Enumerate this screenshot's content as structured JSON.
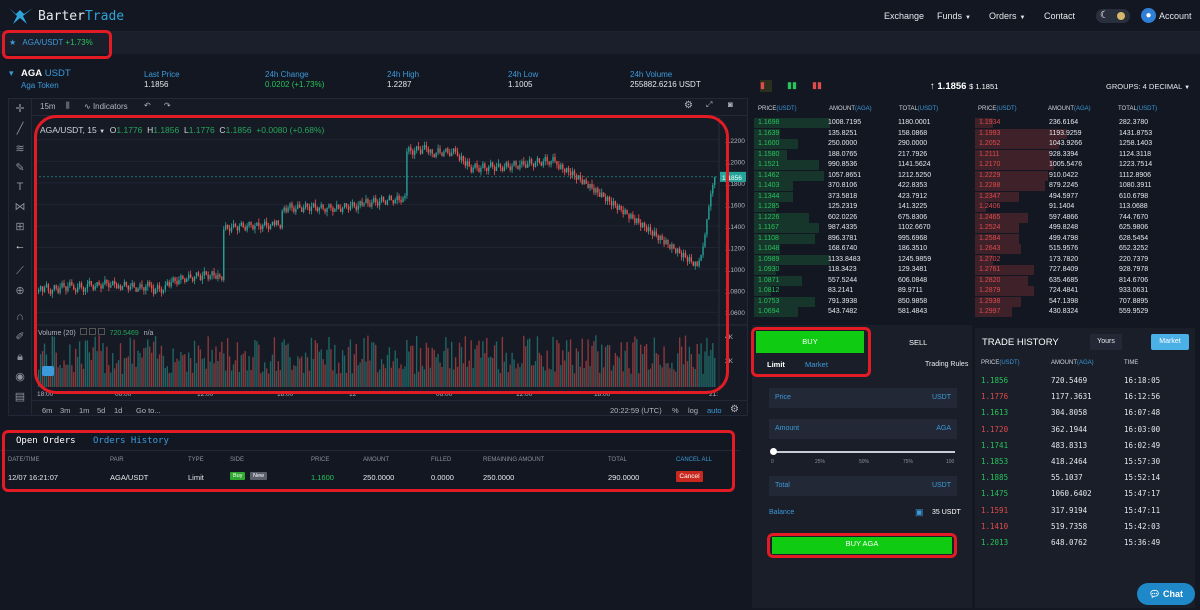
{
  "nav": {
    "brand_a": "Barter",
    "brand_b": "Trade",
    "links": [
      "Exchange",
      "Funds",
      "Orders",
      "Contact"
    ],
    "account": "Account"
  },
  "tab": {
    "pair": "AGA/USDT",
    "change": "+1.73%"
  },
  "ticker": {
    "symbol": "AGA",
    "quote": "USDT",
    "name": "Aga Token",
    "last_price_label": "Last Price",
    "last_price": "1.1856",
    "change_label": "24h Change",
    "change": "0.0202 (+1.73%)",
    "high_label": "24h High",
    "high": "1.2287",
    "low_label": "24h Low",
    "low": "1.1005",
    "volume_label": "24h Volume",
    "volume": "255882.6216 USDT"
  },
  "chart": {
    "interval": "15m",
    "indicators": "Indicators",
    "legend_symbol": "AGA/USDT, 15",
    "o": "1.1776",
    "h": "1.1856",
    "l": "1.1776",
    "c": "1.1856",
    "delta": "+0.0080 (+0.68%)",
    "volume_label": "Volume (20)",
    "volume_value": "720.5469",
    "volume_na": "n/a",
    "price_ticks": [
      "1.2200",
      "1.2000",
      "1.1800",
      "1.1600",
      "1.1400",
      "1.1200",
      "1.1000",
      "1.0800",
      "1.0600"
    ],
    "last_tag": "1.1856",
    "vol_ticks": [
      "4K",
      "2K"
    ],
    "time_ticks": [
      "18:00",
      "06:00",
      "12:00",
      "18:00",
      "12",
      "06:00",
      "12:00",
      "18:00",
      "21:"
    ],
    "ranges": [
      "6m",
      "3m",
      "1m",
      "5d",
      "1d"
    ],
    "goto": "Go to...",
    "clock": "20:22:59 (UTC)",
    "pct": "%",
    "log": "log",
    "auto": "auto",
    "candles": [
      1.081,
      1.084,
      1.079,
      1.083,
      1.086,
      1.08,
      1.077,
      1.081,
      1.085,
      1.082,
      1.078,
      1.083,
      1.087,
      1.084,
      1.08,
      1.084,
      1.088,
      1.085,
      1.081,
      1.079,
      1.083,
      1.087,
      1.083,
      1.079,
      1.082,
      1.086,
      1.089,
      1.085,
      1.081,
      1.084,
      1.088,
      1.085,
      1.082,
      1.086,
      1.09,
      1.087,
      1.083,
      1.085,
      1.089,
      1.086,
      1.082,
      1.085,
      1.081,
      1.084,
      1.088,
      1.085,
      1.081,
      1.084,
      1.087,
      1.083,
      1.079,
      1.082,
      1.086,
      1.083,
      1.08,
      1.084,
      1.088,
      1.085,
      1.082,
      1.077,
      1.081,
      1.085,
      1.082,
      1.078,
      1.081,
      1.085,
      1.088,
      1.084,
      1.088,
      1.092,
      1.089,
      1.086,
      1.09,
      1.094,
      1.091,
      1.088,
      1.091,
      1.095,
      1.092,
      1.089,
      1.093,
      1.097,
      1.094,
      1.09,
      1.094,
      1.098,
      1.095,
      1.091,
      1.094,
      1.098,
      1.094,
      1.091,
      1.095,
      1.093,
      1.09,
      1.137,
      1.141,
      1.138,
      1.135,
      1.139,
      1.142,
      1.139,
      1.136,
      1.14,
      1.143,
      1.139,
      1.136,
      1.14,
      1.144,
      1.141,
      1.137,
      1.14,
      1.143,
      1.14,
      1.137,
      1.141,
      1.144,
      1.14,
      1.137,
      1.141,
      1.144,
      1.141,
      1.145,
      1.141,
      1.138,
      1.154,
      1.157,
      1.153,
      1.157,
      1.161,
      1.157,
      1.153,
      1.156,
      1.16,
      1.157,
      1.153,
      1.157,
      1.161,
      1.158,
      1.154,
      1.158,
      1.161,
      1.157,
      1.154,
      1.157,
      1.16,
      1.156,
      1.153,
      1.157,
      1.16,
      1.157,
      1.153,
      1.156,
      1.16,
      1.156,
      1.153,
      1.157,
      1.161,
      1.158,
      1.155,
      1.159,
      1.162,
      1.158,
      1.155,
      1.159,
      1.163,
      1.159,
      1.161,
      1.165,
      1.161,
      1.158,
      1.162,
      1.166,
      1.162,
      1.159,
      1.163,
      1.167,
      1.163,
      1.16,
      1.164,
      1.168,
      1.164,
      1.161,
      1.164,
      1.168,
      1.164,
      1.162,
      1.166,
      1.168,
      1.209,
      1.213,
      1.21,
      1.206,
      1.21,
      1.214,
      1.211,
      1.207,
      1.211,
      1.215,
      1.212,
      1.208,
      1.211,
      1.207,
      1.204,
      1.208,
      1.212,
      1.208,
      1.205,
      1.209,
      1.212,
      1.208,
      1.205,
      1.208,
      1.212,
      1.209,
      1.205,
      1.201,
      1.205,
      1.2,
      1.196,
      1.2,
      1.195,
      1.19,
      1.194,
      1.198,
      1.194,
      1.19,
      1.194,
      1.198,
      1.194,
      1.191,
      1.195,
      1.199,
      1.195,
      1.191,
      1.195,
      1.198,
      1.194,
      1.191,
      1.195,
      1.199,
      1.195,
      1.192,
      1.196,
      1.2,
      1.196,
      1.193,
      1.197,
      1.2,
      1.197,
      1.194,
      1.198,
      1.202,
      1.198,
      1.195,
      1.199,
      1.203,
      1.199,
      1.196,
      1.2,
      1.204,
      1.2,
      1.197,
      1.2,
      1.204,
      1.2,
      1.197,
      1.193,
      1.197,
      1.193,
      1.19,
      1.194,
      1.19,
      1.187,
      1.191,
      1.187,
      1.183,
      1.187,
      1.183,
      1.179,
      1.183,
      1.179,
      1.175,
      1.179,
      1.175,
      1.171,
      1.175,
      1.171,
      1.167,
      1.171,
      1.167,
      1.163,
      1.167,
      1.163,
      1.159,
      1.163,
      1.159,
      1.155,
      1.159,
      1.155,
      1.151,
      1.155,
      1.151,
      1.147,
      1.151,
      1.147,
      1.143,
      1.147,
      1.143,
      1.139,
      1.143,
      1.139,
      1.135,
      1.139,
      1.135,
      1.131,
      1.135,
      1.131,
      1.127,
      1.131,
      1.127,
      1.123,
      1.127,
      1.123,
      1.119,
      1.123,
      1.119,
      1.115,
      1.119,
      1.115,
      1.111,
      1.115,
      1.111,
      1.107,
      1.111,
      1.107,
      1.103,
      1.107,
      1.103,
      1.108,
      1.113,
      1.121,
      1.132,
      1.146,
      1.158,
      1.17,
      1.178,
      1.1856
    ]
  },
  "orders": {
    "tab_open": "Open Orders",
    "tab_history": "Orders History",
    "headers": [
      "DATE/TIME",
      "PAIR",
      "TYPE",
      "SIDE",
      "PRICE",
      "AMOUNT",
      "FILLED",
      "REMAINING AMOUNT",
      "TOTAL",
      "CANCEL ALL"
    ],
    "row": {
      "date": "12/07 16:21:07",
      "pair": "AGA/USDT",
      "type": "Limit",
      "side": "Buy",
      "tag": "New",
      "price": "1.1600",
      "amount": "250.0000",
      "filled": "0.0000",
      "remaining": "250.0000",
      "total": "290.0000",
      "cancel": "Cancel"
    }
  },
  "orderbook": {
    "price": "1.1856",
    "usd": "$ 1.1851",
    "groups": "GROUPS: 4 DECIMAL",
    "h_price": "PRICE",
    "h_amount": "AMOUNT",
    "h_total": "TOTAL",
    "u_usdt": "(USDT)",
    "u_aga": "(AGA)",
    "bids": [
      [
        "1.1698",
        "1008.7195",
        "1180.0001"
      ],
      [
        "1.1639",
        "135.8251",
        "158.0868"
      ],
      [
        "1.1600",
        "250.0000",
        "290.0000"
      ],
      [
        "1.1580",
        "188.0765",
        "217.7926"
      ],
      [
        "1.1521",
        "990.8536",
        "1141.5624"
      ],
      [
        "1.1462",
        "1057.8651",
        "1212.5250"
      ],
      [
        "1.1403",
        "370.8106",
        "422.8353"
      ],
      [
        "1.1344",
        "373.5818",
        "423.7912"
      ],
      [
        "1.1285",
        "125.2319",
        "141.3225"
      ],
      [
        "1.1226",
        "602.0226",
        "675.8306"
      ],
      [
        "1.1167",
        "987.4335",
        "1102.6670"
      ],
      [
        "1.1108",
        "896.3781",
        "995.6968"
      ],
      [
        "1.1048",
        "168.6740",
        "186.3510"
      ],
      [
        "1.0989",
        "1133.8483",
        "1245.9859"
      ],
      [
        "1.0930",
        "118.3423",
        "129.3481"
      ],
      [
        "1.0871",
        "557.5244",
        "606.0848"
      ],
      [
        "1.0812",
        "83.2141",
        "89.9711"
      ],
      [
        "1.0753",
        "791.3938",
        "850.9858"
      ],
      [
        "1.0694",
        "543.7482",
        "581.4843"
      ]
    ],
    "asks": [
      [
        "1.1934",
        "236.6164",
        "282.3780"
      ],
      [
        "1.1993",
        "1193.9259",
        "1431.8753"
      ],
      [
        "1.2052",
        "1043.9266",
        "1258.1403"
      ],
      [
        "1.2111",
        "928.3394",
        "1124.3118"
      ],
      [
        "1.2170",
        "1005.5476",
        "1223.7514"
      ],
      [
        "1.2229",
        "910.0422",
        "1112.8906"
      ],
      [
        "1.2288",
        "879.2245",
        "1080.3911"
      ],
      [
        "1.2347",
        "494.5977",
        "610.6798"
      ],
      [
        "1.2406",
        "91.1404",
        "113.0688"
      ],
      [
        "1.2465",
        "597.4866",
        "744.7670"
      ],
      [
        "1.2524",
        "499.8248",
        "625.9806"
      ],
      [
        "1.2584",
        "499.4798",
        "628.5454"
      ],
      [
        "1.2643",
        "515.9576",
        "652.3252"
      ],
      [
        "1.2702",
        "173.7820",
        "220.7379"
      ],
      [
        "1.2761",
        "727.8409",
        "928.7978"
      ],
      [
        "1.2820",
        "635.4685",
        "814.6706"
      ],
      [
        "1.2879",
        "724.4841",
        "933.0631"
      ],
      [
        "1.2938",
        "547.1398",
        "707.8895"
      ],
      [
        "1.2997",
        "430.8324",
        "559.9529"
      ]
    ],
    "bid_depth": [
      0.35,
      0.12,
      0.2,
      0.15,
      0.3,
      0.32,
      0.18,
      0.18,
      0.1,
      0.25,
      0.3,
      0.28,
      0.12,
      0.35,
      0.1,
      0.22,
      0.08,
      0.28,
      0.2
    ],
    "ask_depth": [
      0.08,
      0.42,
      0.38,
      0.34,
      0.36,
      0.33,
      0.32,
      0.2,
      0.05,
      0.24,
      0.2,
      0.2,
      0.21,
      0.08,
      0.27,
      0.24,
      0.27,
      0.21,
      0.17
    ]
  },
  "trade": {
    "buy": "BUY",
    "sell": "SELL",
    "limit": "Limit",
    "market": "Market",
    "rules": "Trading Rules",
    "price_label": "Price",
    "amount_label": "Amount",
    "total_label": "Total",
    "usdt": "USDT",
    "aga": "AGA",
    "slider_ticks": [
      "0",
      "25%",
      "50%",
      "75%",
      "100"
    ],
    "balance_label": "Balance",
    "balance_value": "35 USDT",
    "buy_aga": "BUY AGA"
  },
  "history": {
    "title": "TRADE HISTORY",
    "yours": "Yours",
    "market": "Market",
    "h_price": "PRICE",
    "h_amount": "AMOUNT",
    "h_time": "TIME",
    "u_usdt": "(USDT)",
    "u_aga": "(AGA)",
    "rows": [
      [
        "1.1856",
        "720.5469",
        "16:18:05",
        "up"
      ],
      [
        "1.1776",
        "1177.3631",
        "16:12:56",
        "down"
      ],
      [
        "1.1613",
        "304.8058",
        "16:07:48",
        "up"
      ],
      [
        "1.1720",
        "362.1944",
        "16:03:00",
        "down"
      ],
      [
        "1.1741",
        "483.8313",
        "16:02:49",
        "up"
      ],
      [
        "1.1853",
        "418.2464",
        "15:57:30",
        "up"
      ],
      [
        "1.1885",
        "55.1037",
        "15:52:14",
        "up"
      ],
      [
        "1.1475",
        "1060.6402",
        "15:47:17",
        "up"
      ],
      [
        "1.1591",
        "317.9194",
        "15:47:11",
        "down"
      ],
      [
        "1.1410",
        "519.7358",
        "15:42:03",
        "down"
      ],
      [
        "1.2013",
        "648.0762",
        "15:36:49",
        "up"
      ]
    ]
  },
  "chat": "Chat",
  "colors": {
    "green": "#26c45b",
    "red": "#e04b4b",
    "accent": "#3b9ad9",
    "buy_btn": "#0fcb12",
    "highlight": "#e21b24"
  }
}
